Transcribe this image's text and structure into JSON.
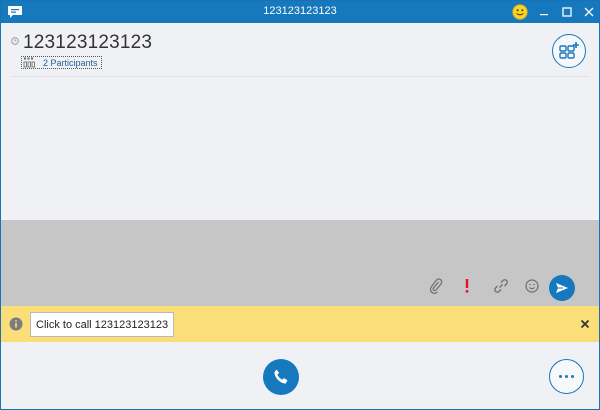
{
  "window": {
    "title": "123123123123",
    "accent_color": "#1678bd"
  },
  "header": {
    "conversation_title": "123123123123",
    "participants_label": "2 Participants"
  },
  "compose": {
    "tools": [
      "attach-icon",
      "important-icon",
      "link-icon",
      "emoticon-icon"
    ],
    "send_icon": "send-icon"
  },
  "notification": {
    "call_text": "Click to call 123123123123",
    "background_color": "#fadf79"
  },
  "footer": {
    "call_icon": "phone-icon",
    "more_icon": "more-options-icon"
  }
}
